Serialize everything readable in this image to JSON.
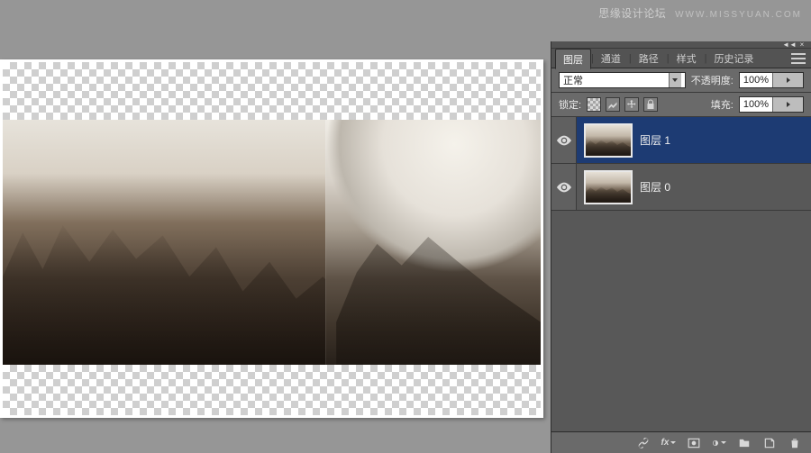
{
  "watermark": {
    "title": "思缘设计论坛",
    "url": "WWW.MISSYUAN.COM"
  },
  "panel": {
    "tabs": [
      "图层",
      "通道",
      "路径",
      "样式",
      "历史记录"
    ],
    "active_tab": 0,
    "blend_mode": "正常",
    "opacity_label": "不透明度:",
    "opacity_value": "100%",
    "lock_label": "锁定:",
    "fill_label": "填充:",
    "fill_value": "100%",
    "layers": [
      {
        "name": "图层 1",
        "visible": true,
        "selected": true
      },
      {
        "name": "图层 0",
        "visible": true,
        "selected": false
      }
    ],
    "footer_icons": [
      "link",
      "fx",
      "mask",
      "adjustment",
      "group",
      "new-layer",
      "trash"
    ]
  }
}
